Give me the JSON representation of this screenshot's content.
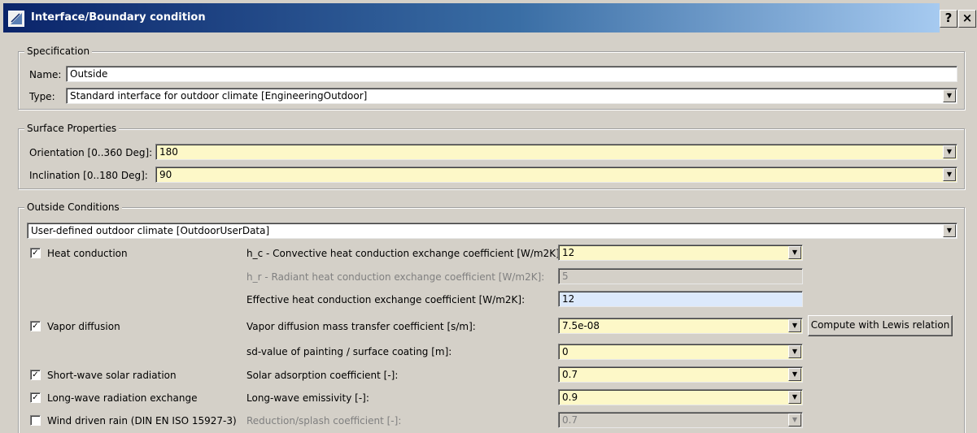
{
  "window": {
    "title": "Interface/Boundary condition",
    "help_label": "?",
    "close_label": "×"
  },
  "specification": {
    "title": "Specification",
    "name_label": "Name:",
    "name_value": "Outside",
    "type_label": "Type:",
    "type_value": "Standard interface for outdoor climate [EngineeringOutdoor]"
  },
  "surface": {
    "title": "Surface Properties",
    "orientation_label": "Orientation [0..360 Deg]:",
    "orientation_value": "180",
    "inclination_label": "Inclination [0..180 Deg]:",
    "inclination_value": "90"
  },
  "outside": {
    "title": "Outside Conditions",
    "climate_value": "User-defined outdoor climate [OutdoorUserData]",
    "heat_conduction": {
      "label": "Heat conduction",
      "checked": true,
      "hc_label": "h_c - Convective heat conduction exchange coefficient [W/m2K]:",
      "hc_value": "12",
      "hr_label": "h_r - Radiant heat conduction exchange coefficient [W/m2K]:",
      "hr_value": "5",
      "eff_label": "Effective heat conduction exchange coefficient [W/m2K]:",
      "eff_value": "12"
    },
    "vapor_diffusion": {
      "label": "Vapor diffusion",
      "checked": true,
      "coef_label": "Vapor diffusion mass transfer coefficient [s/m]:",
      "coef_value": "7.5e-08",
      "lewis_button": "Compute with Lewis relation",
      "sd_label": "sd-value of painting / surface coating [m]:",
      "sd_value": "0"
    },
    "shortwave": {
      "label": "Short-wave solar radiation",
      "checked": true,
      "coef_label": "Solar adsorption coefficient [-]:",
      "coef_value": "0.7"
    },
    "longwave": {
      "label": "Long-wave radiation exchange",
      "checked": true,
      "coef_label": "Long-wave emissivity [-]:",
      "coef_value": "0.9"
    },
    "rain": {
      "label": "Wind driven rain (DIN EN ISO 15927-3)",
      "checked": false,
      "coef_label": "Reduction/splash coefficient [-]:",
      "coef_value": "0.7"
    }
  },
  "icons": {
    "dropdown": "chevron-down-icon",
    "check": "checkmark-icon",
    "app": "app-icon"
  }
}
